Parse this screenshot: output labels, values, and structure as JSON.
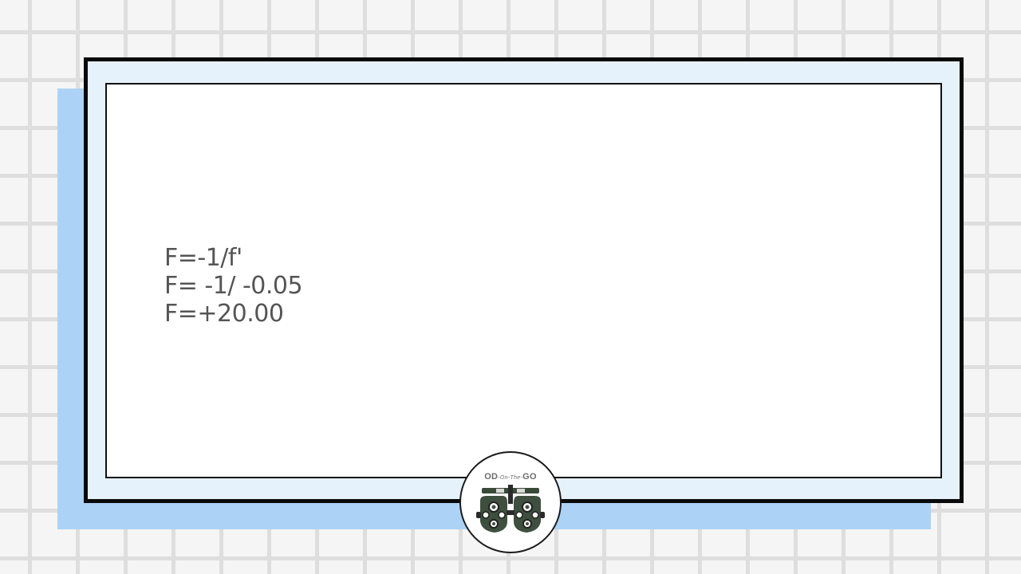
{
  "slide": {
    "formula_lines": [
      "F=-1/f'",
      "F= -1/ -0.05",
      "F=+20.00"
    ]
  },
  "logo": {
    "icon": "phoropter-icon",
    "text_left": "OD",
    "text_mid": "-On-The-",
    "text_right": "GO"
  },
  "colors": {
    "background": "#f5f5f5",
    "grid_lines": "#dedede",
    "shadow_panel": "#acd3f6",
    "frame_fill": "#e6f2fb",
    "frame_border": "#0a0a0a",
    "text": "#555555"
  }
}
